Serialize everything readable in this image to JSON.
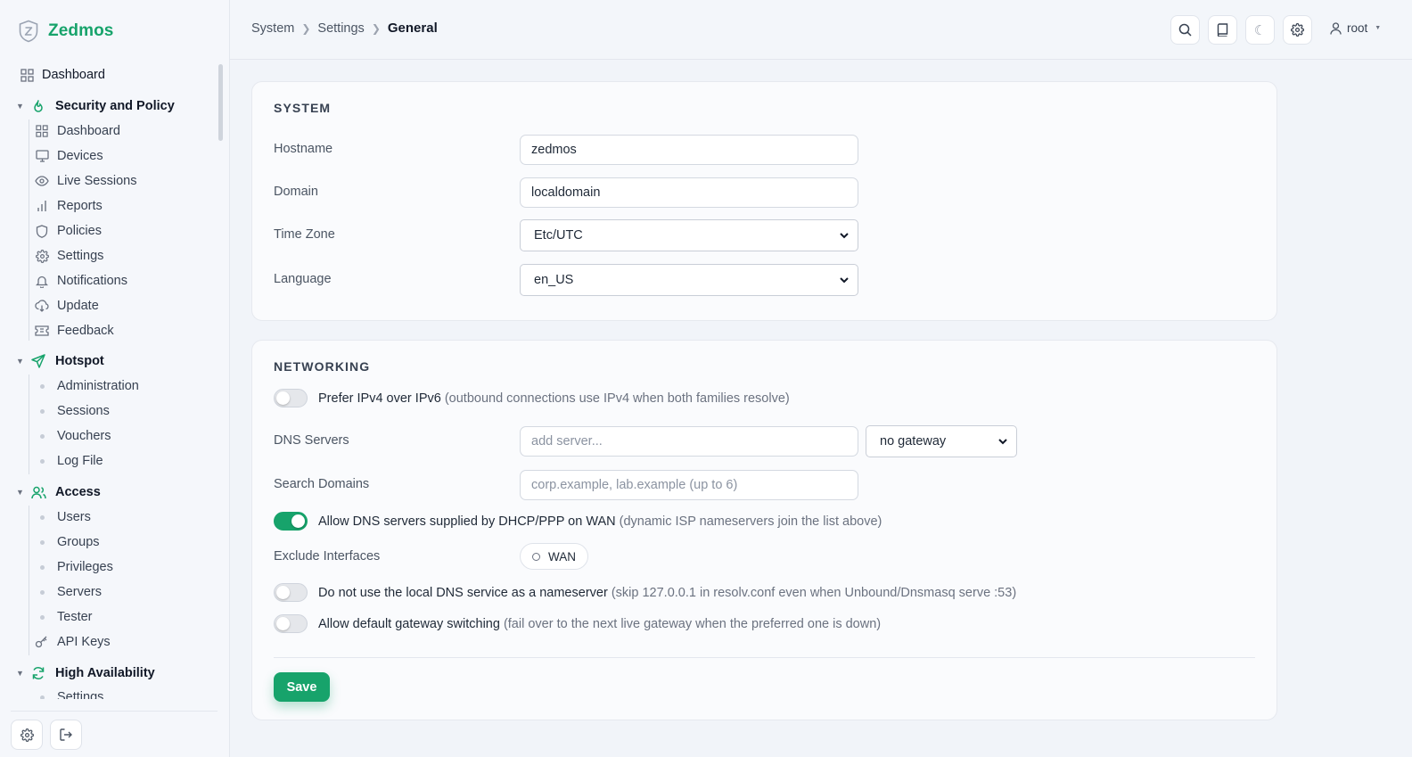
{
  "app": {
    "name": "Zedmos"
  },
  "breadcrumb": [
    "System",
    "Settings",
    "General"
  ],
  "topbar": {
    "user": "root"
  },
  "sidebar": {
    "dashboard": "Dashboard",
    "groups": [
      {
        "label": "Security and Policy",
        "items": [
          "Dashboard",
          "Devices",
          "Live Sessions",
          "Reports",
          "Policies",
          "Settings",
          "Notifications",
          "Update",
          "Feedback"
        ]
      },
      {
        "label": "Hotspot",
        "items": [
          "Administration",
          "Sessions",
          "Vouchers",
          "Log File"
        ]
      },
      {
        "label": "Access",
        "items": [
          "Users",
          "Groups",
          "Privileges",
          "Servers",
          "Tester",
          "API Keys"
        ]
      },
      {
        "label": "High Availability",
        "items": [
          "Settings"
        ]
      }
    ]
  },
  "system": {
    "title": "SYSTEM",
    "hostname_label": "Hostname",
    "hostname": "zedmos",
    "domain_label": "Domain",
    "domain": "localdomain",
    "timezone_label": "Time Zone",
    "timezone": "Etc/UTC",
    "language_label": "Language",
    "language": "en_US"
  },
  "networking": {
    "title": "NETWORKING",
    "prefer_ipv4": {
      "label": "Prefer IPv4 over IPv6",
      "hint": "(outbound connections use IPv4 when both families resolve)",
      "on": false
    },
    "dns_label": "DNS Servers",
    "dns_placeholder": "add server...",
    "gateway": "no gateway",
    "search_label": "Search Domains",
    "search_placeholder": "corp.example, lab.example (up to 6)",
    "allow_dhcp": {
      "label": "Allow DNS servers supplied by DHCP/PPP on WAN",
      "hint": "(dynamic ISP nameservers join the list above)",
      "on": true
    },
    "exclude_label": "Exclude Interfaces",
    "exclude_chip": "WAN",
    "no_local": {
      "label": "Do not use the local DNS service as a nameserver",
      "hint": "(skip 127.0.0.1 in resolv.conf even when Unbound/Dnsmasq serve :53)",
      "on": false
    },
    "gw_switch": {
      "label": "Allow default gateway switching",
      "hint": "(fail over to the next live gateway when the preferred one is down)",
      "on": false
    },
    "save": "Save"
  },
  "colors": {
    "accent": "#17a36b"
  }
}
